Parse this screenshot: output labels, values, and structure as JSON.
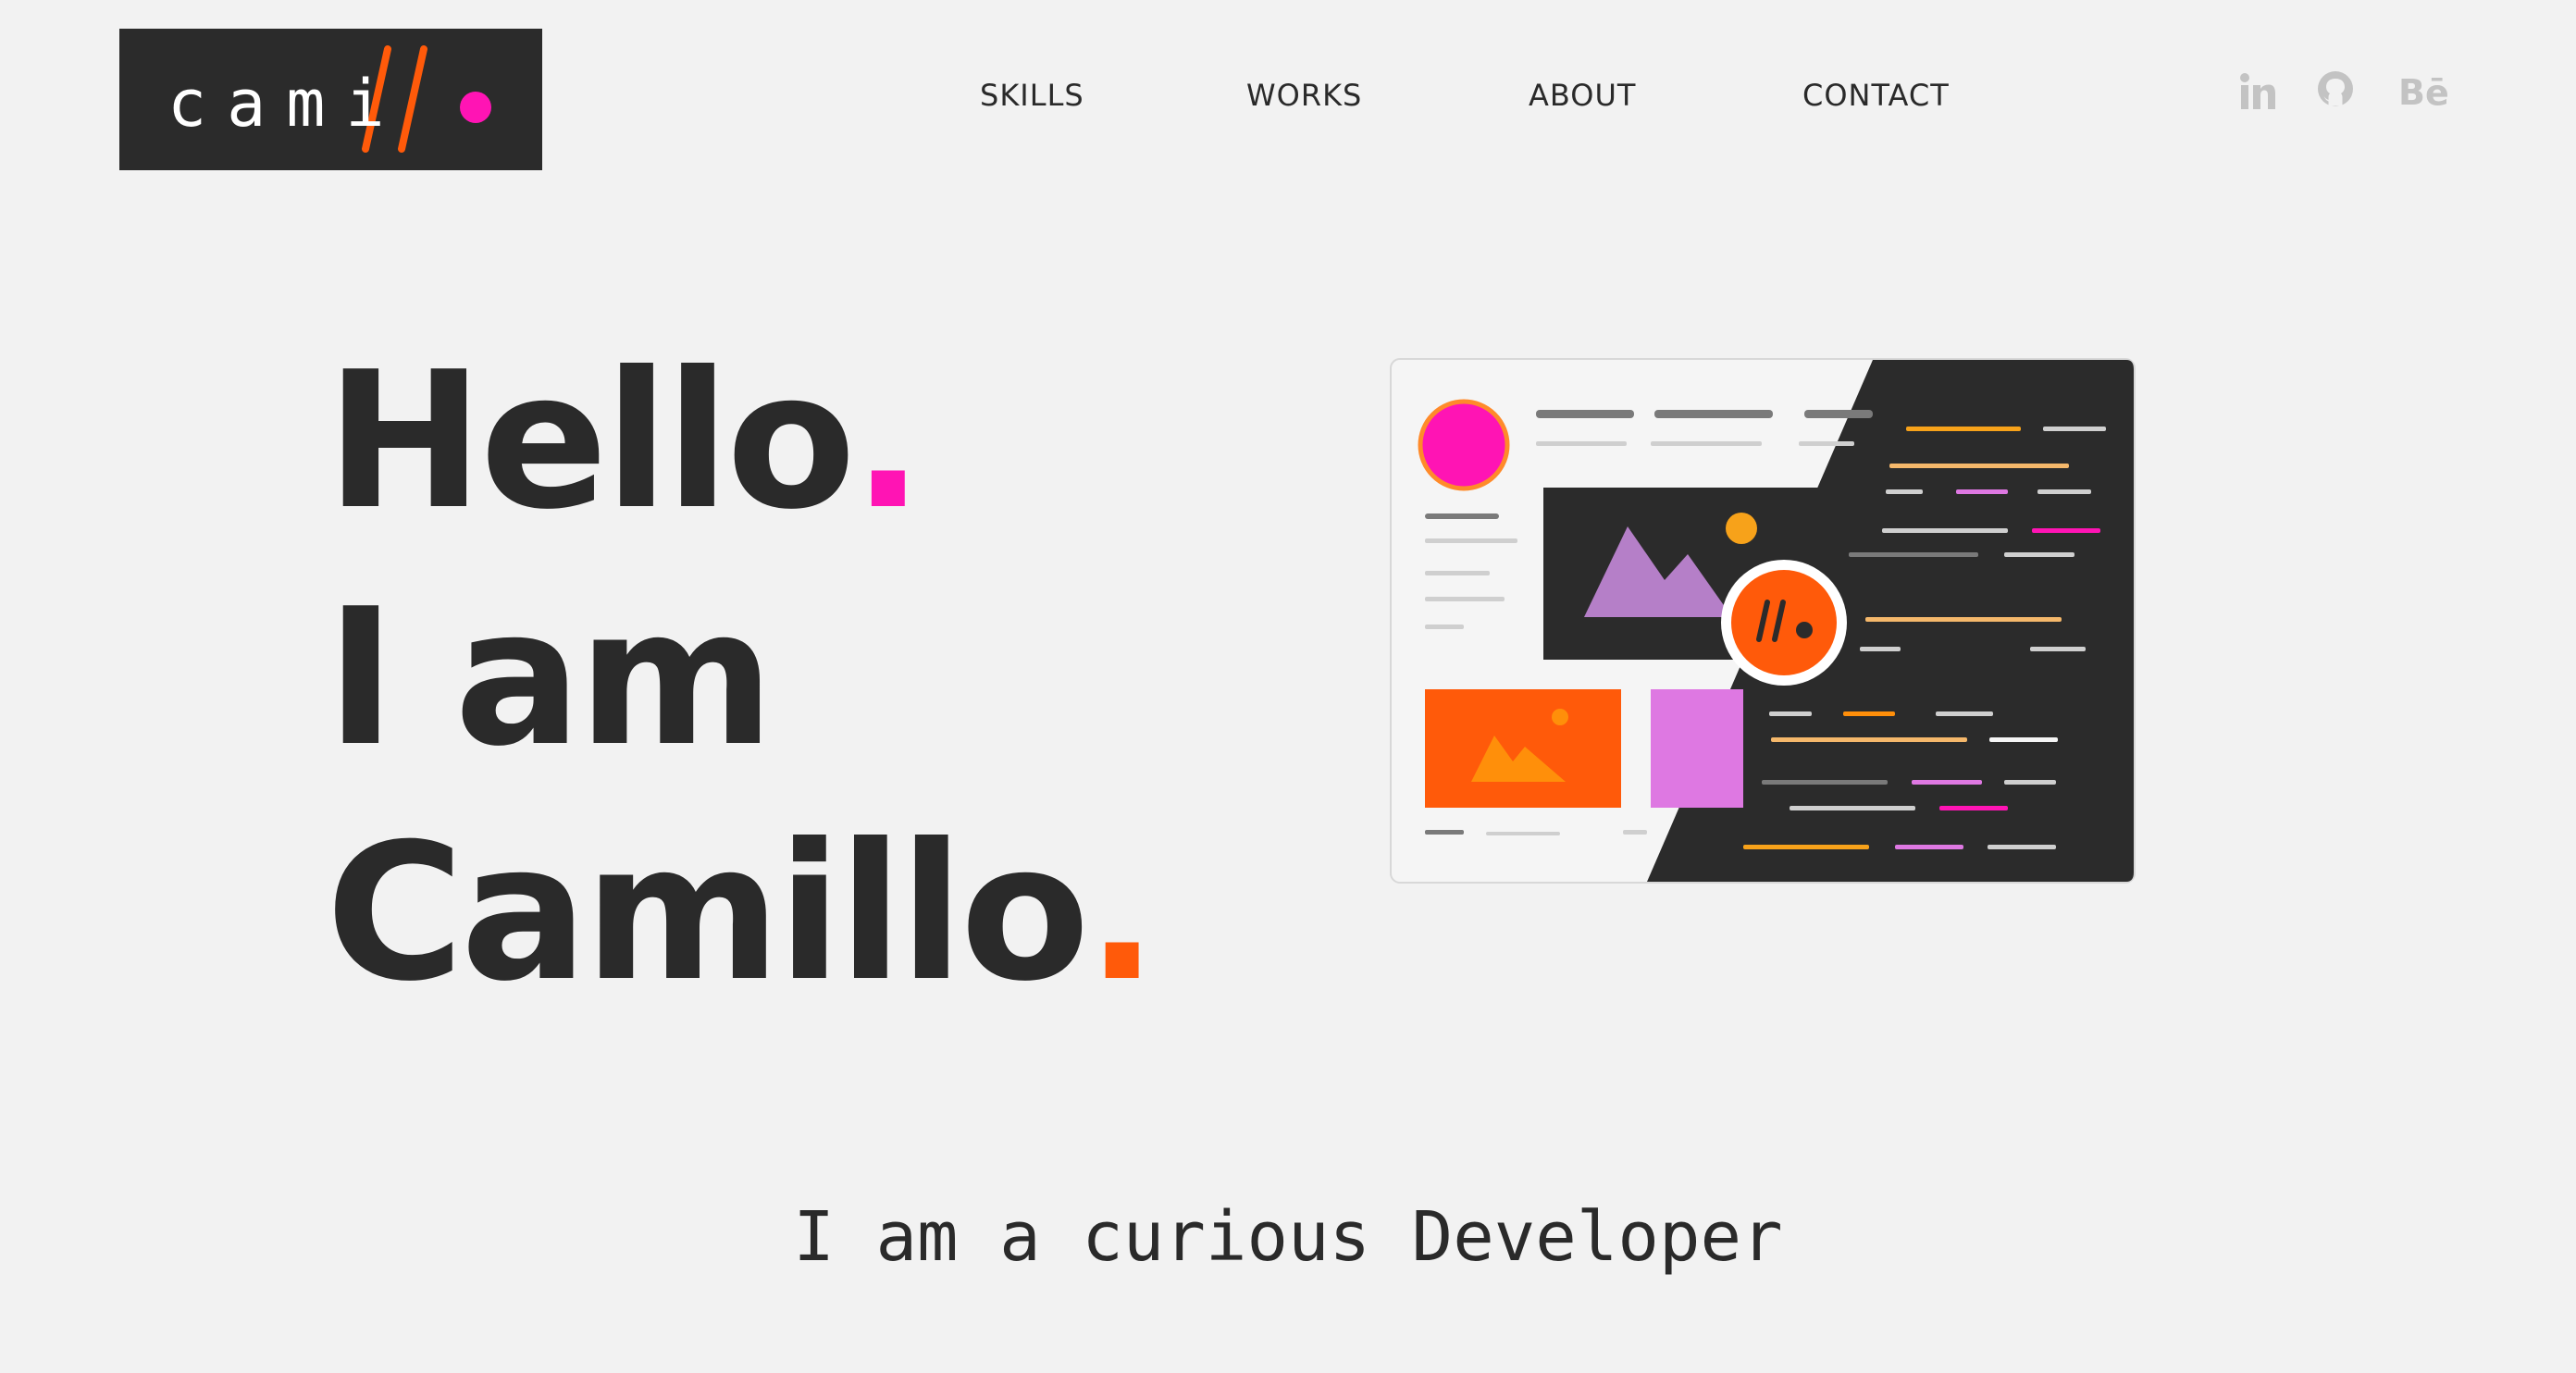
{
  "brand": {
    "logo_text": "cami",
    "colors": {
      "accent_orange": "#ff5a0a",
      "accent_pink": "#ff14b4",
      "dark": "#2b2b2b",
      "background": "#f2f2f2"
    }
  },
  "nav": {
    "items": [
      {
        "label": "SKILLS"
      },
      {
        "label": "WORKS"
      },
      {
        "label": "ABOUT"
      },
      {
        "label": "CONTACT"
      }
    ]
  },
  "social": {
    "icons": [
      "linkedin-icon",
      "github-icon",
      "behance-icon"
    ],
    "linkedin_label": "in",
    "behance_label": "Bē"
  },
  "hero": {
    "line1": "Hello",
    "line2": "I am",
    "line3": "Camillo",
    "dot": "."
  },
  "subtitle": "I am a curious Developer"
}
